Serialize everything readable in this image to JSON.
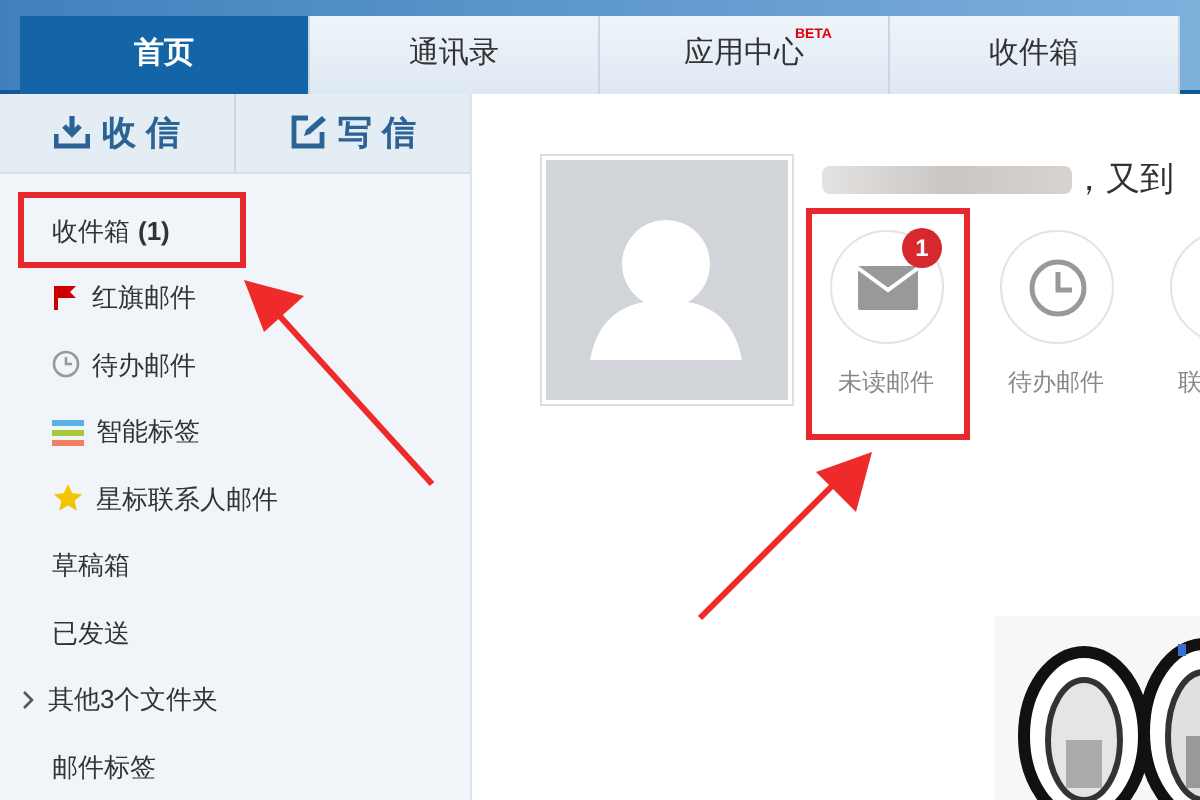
{
  "tabs": [
    {
      "label": "首页",
      "selected": true
    },
    {
      "label": "通讯录",
      "selected": false
    },
    {
      "label": "应用中心",
      "selected": false,
      "badge": "BETA"
    },
    {
      "label": "收件箱",
      "selected": false
    }
  ],
  "sidebar": {
    "actions": [
      {
        "label": "收 信",
        "kind": "receive"
      },
      {
        "label": "写 信",
        "kind": "compose"
      }
    ],
    "folders": [
      {
        "label": "收件箱",
        "count": "(1)",
        "kind": "plain"
      },
      {
        "label": "红旗邮件",
        "kind": "flag"
      },
      {
        "label": "待办邮件",
        "kind": "clock"
      },
      {
        "label": "智能标签",
        "kind": "tags"
      },
      {
        "label": "星标联系人邮件",
        "kind": "star"
      },
      {
        "label": "草稿箱",
        "kind": "plain"
      },
      {
        "label": "已发送",
        "kind": "plain"
      },
      {
        "label": "其他3个文件夹",
        "kind": "expand"
      },
      {
        "label": "邮件标签",
        "kind": "plain"
      }
    ]
  },
  "greeting": "，又到",
  "quick_items": [
    {
      "label": "未读邮件",
      "kind": "mail",
      "badge": "1"
    },
    {
      "label": "待办邮件",
      "kind": "clock"
    },
    {
      "label": "联",
      "kind": "contact"
    }
  ]
}
